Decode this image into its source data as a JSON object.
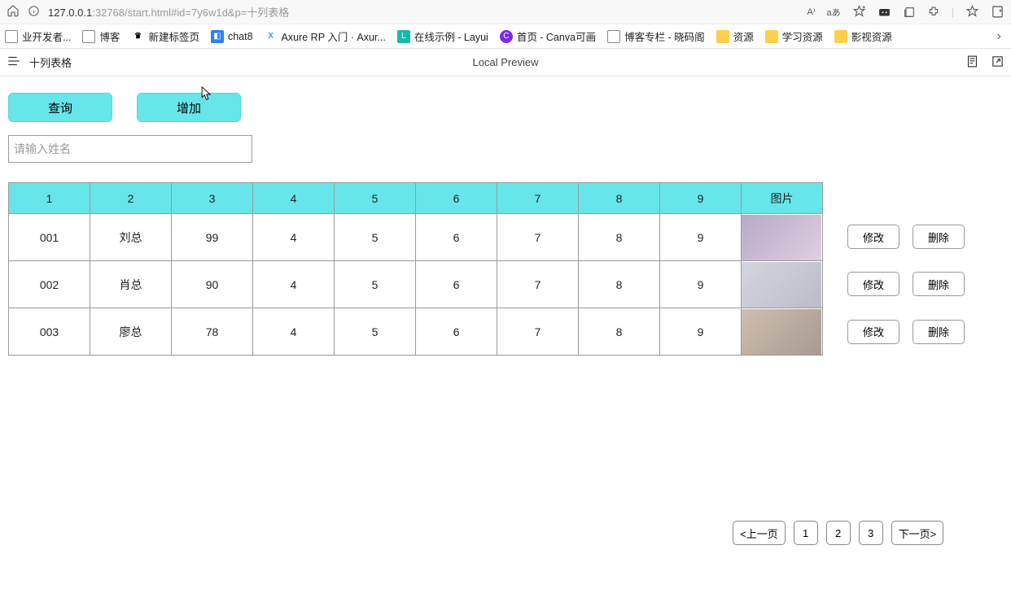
{
  "browser": {
    "url_prefix": "127.0.0.1",
    "url_rest": ":32768/start.html#id=7y6w1d&p=十列表格",
    "read_aloud": "A⁾",
    "translate": "aあ"
  },
  "bookmarks": {
    "items": [
      {
        "icon": "page",
        "label": "业开发者..."
      },
      {
        "icon": "page",
        "label": "博客"
      },
      {
        "icon": "crown",
        "label": "新建标签页"
      },
      {
        "icon": "chat",
        "label": "chat8"
      },
      {
        "icon": "axure",
        "label": "Axure RP 入门 · Axur..."
      },
      {
        "icon": "layui",
        "label": "在线示例 - Layui"
      },
      {
        "icon": "canva",
        "label": "首页 - Canva可画"
      },
      {
        "icon": "page",
        "label": "博客专栏 - 晓码阁"
      },
      {
        "icon": "folder",
        "label": "资源"
      },
      {
        "icon": "folder",
        "label": "学习资源"
      },
      {
        "icon": "folder",
        "label": "影视资源"
      }
    ]
  },
  "axure": {
    "page_name": "十列表格",
    "center": "Local Preview"
  },
  "toolbar": {
    "query_label": "查询",
    "add_label": "增加"
  },
  "search": {
    "placeholder": "请输入姓名",
    "value": ""
  },
  "table": {
    "headers": [
      "1",
      "2",
      "3",
      "4",
      "5",
      "6",
      "7",
      "8",
      "9",
      "图片"
    ],
    "rows": [
      {
        "cells": [
          "001",
          "刘总",
          "99",
          "4",
          "5",
          "6",
          "7",
          "8",
          "9"
        ],
        "thumb": "thumb"
      },
      {
        "cells": [
          "002",
          "肖总",
          "90",
          "4",
          "5",
          "6",
          "7",
          "8",
          "9"
        ],
        "thumb": "thumb thumb2"
      },
      {
        "cells": [
          "003",
          "廖总",
          "78",
          "4",
          "5",
          "6",
          "7",
          "8",
          "9"
        ],
        "thumb": "thumb thumb3"
      }
    ],
    "edit_label": "修改",
    "delete_label": "删除"
  },
  "pager": {
    "prev": "<上一页",
    "pages": [
      "1",
      "2",
      "3"
    ],
    "next": "下一页>"
  }
}
